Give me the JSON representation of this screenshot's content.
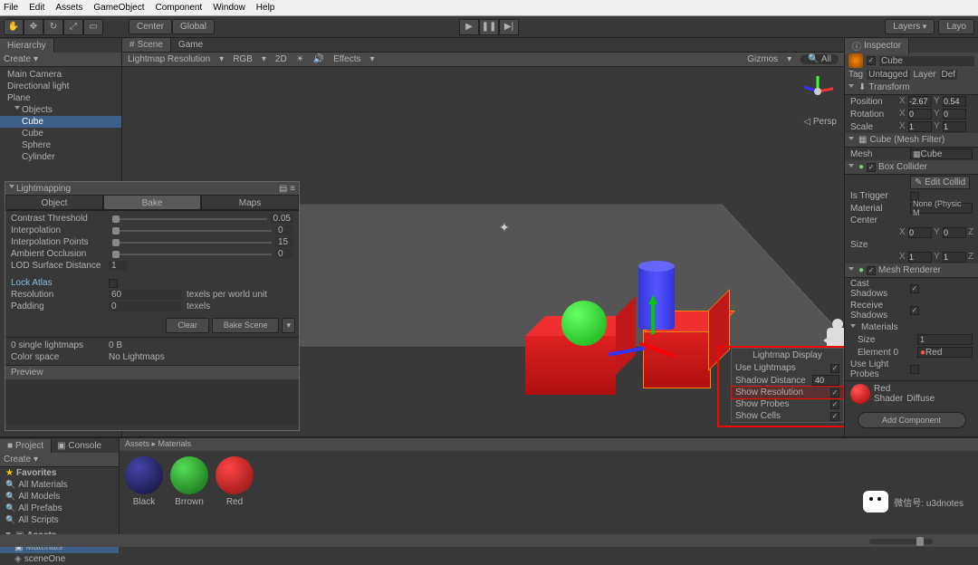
{
  "menubar": [
    "File",
    "Edit",
    "Assets",
    "GameObject",
    "Component",
    "Window",
    "Help"
  ],
  "toolbar": {
    "center": "Center",
    "global": "Global",
    "layers": "Layers",
    "layout": "Layo"
  },
  "hierarchy": {
    "title": "Hierarchy",
    "create": "Create",
    "items": [
      "Main Camera",
      "Directional light",
      "Plane"
    ],
    "objects_label": "Objects",
    "children": [
      {
        "name": "Cube",
        "sel": true
      },
      {
        "name": "Cube"
      },
      {
        "name": "Sphere"
      },
      {
        "name": "Cylinder"
      }
    ]
  },
  "scene": {
    "tab1": "Scene",
    "tab2": "Game",
    "toolbar": {
      "mode": "Lightmap Resolution",
      "rgb": "RGB",
      "dim": "2D",
      "lights_on": true,
      "effects": "Effects",
      "gizmos": "Gizmos",
      "all": "All"
    },
    "persp": "Persp"
  },
  "lightmap_display": {
    "title": "Lightmap Display",
    "rows": [
      {
        "label": "Use Lightmaps",
        "check": true
      },
      {
        "label": "Shadow Distance",
        "value": "40"
      },
      {
        "label": "Show Resolution",
        "check": true,
        "hl": true
      },
      {
        "label": "Show Probes",
        "check": true
      },
      {
        "label": "Show Cells",
        "check": true
      }
    ]
  },
  "lm_window": {
    "title": "Lightmapping",
    "tabs": [
      "Object",
      "Bake",
      "Maps"
    ],
    "rows": [
      {
        "label": "Contrast Threshold",
        "value": "0.05"
      },
      {
        "label": "Interpolation",
        "value": "0"
      },
      {
        "label": "Interpolation Points",
        "value": "15"
      },
      {
        "label": "Ambient Occlusion",
        "value": "0"
      },
      {
        "label": "LOD Surface Distance",
        "value": "1"
      }
    ],
    "lock": "Lock Atlas",
    "res_label": "Resolution",
    "res_val": "60",
    "res_unit": "texels per world unit",
    "pad_label": "Padding",
    "pad_val": "0",
    "pad_unit": "texels",
    "clear": "Clear",
    "bake": "Bake Scene",
    "single": "0 single lightmaps",
    "size": "0 B",
    "colorspace": "Color space",
    "nolm": "No Lightmaps",
    "preview": "Preview"
  },
  "inspector": {
    "title": "Inspector",
    "name": "Cube",
    "tag_lbl": "Tag",
    "tag_val": "Untagged",
    "layer_lbl": "Layer",
    "layer_val": "Def",
    "transform": "Transform",
    "pos": "Position",
    "rot": "Rotation",
    "scale": "Scale",
    "px": "-2.67",
    "py": "0.54",
    "rx": "0",
    "ry": "0",
    "sx": "1",
    "sy": "1",
    "meshfilter": "Cube (Mesh Filter)",
    "mesh_lbl": "Mesh",
    "mesh_val": "Cube",
    "boxcol": "Box Collider",
    "editcol": "Edit Collid",
    "trigger": "Is Trigger",
    "material_lbl": "Material",
    "material_val": "None (Physic M",
    "center_lbl": "Center",
    "cx": "0",
    "cy": "0",
    "size_lbl": "Size",
    "szx": "1",
    "szy": "1",
    "meshrend": "Mesh Renderer",
    "cast": "Cast Shadows",
    "recv": "Receive Shadows",
    "mats": "Materials",
    "size1": "Size",
    "size1v": "1",
    "el0": "Element 0",
    "el0v": "Red",
    "probes": "Use Light Probes",
    "shader_name": "Red",
    "shader_lbl": "Shader",
    "shader_val": "Diffuse",
    "addcomp": "Add Component"
  },
  "project": {
    "tab1": "Project",
    "tab2": "Console",
    "create": "Create",
    "fav": "Favorites",
    "favs": [
      "All Materials",
      "All Models",
      "All Prefabs",
      "All Scripts"
    ],
    "assets": "Assets",
    "folders": [
      "Materials",
      "sceneOne"
    ]
  },
  "assets_panel": {
    "breadcrumb": "Assets ▸ Materials",
    "mats": [
      {
        "name": "Black",
        "color": "radial-gradient(circle at 35% 30%,#44a,#113)"
      },
      {
        "name": "Brrown",
        "color": "radial-gradient(circle at 35% 30%,#5d5,#161)"
      },
      {
        "name": "Red",
        "color": "radial-gradient(circle at 35% 30%,#f44,#811)"
      }
    ]
  },
  "watermark": "微信号: u3dnotes"
}
